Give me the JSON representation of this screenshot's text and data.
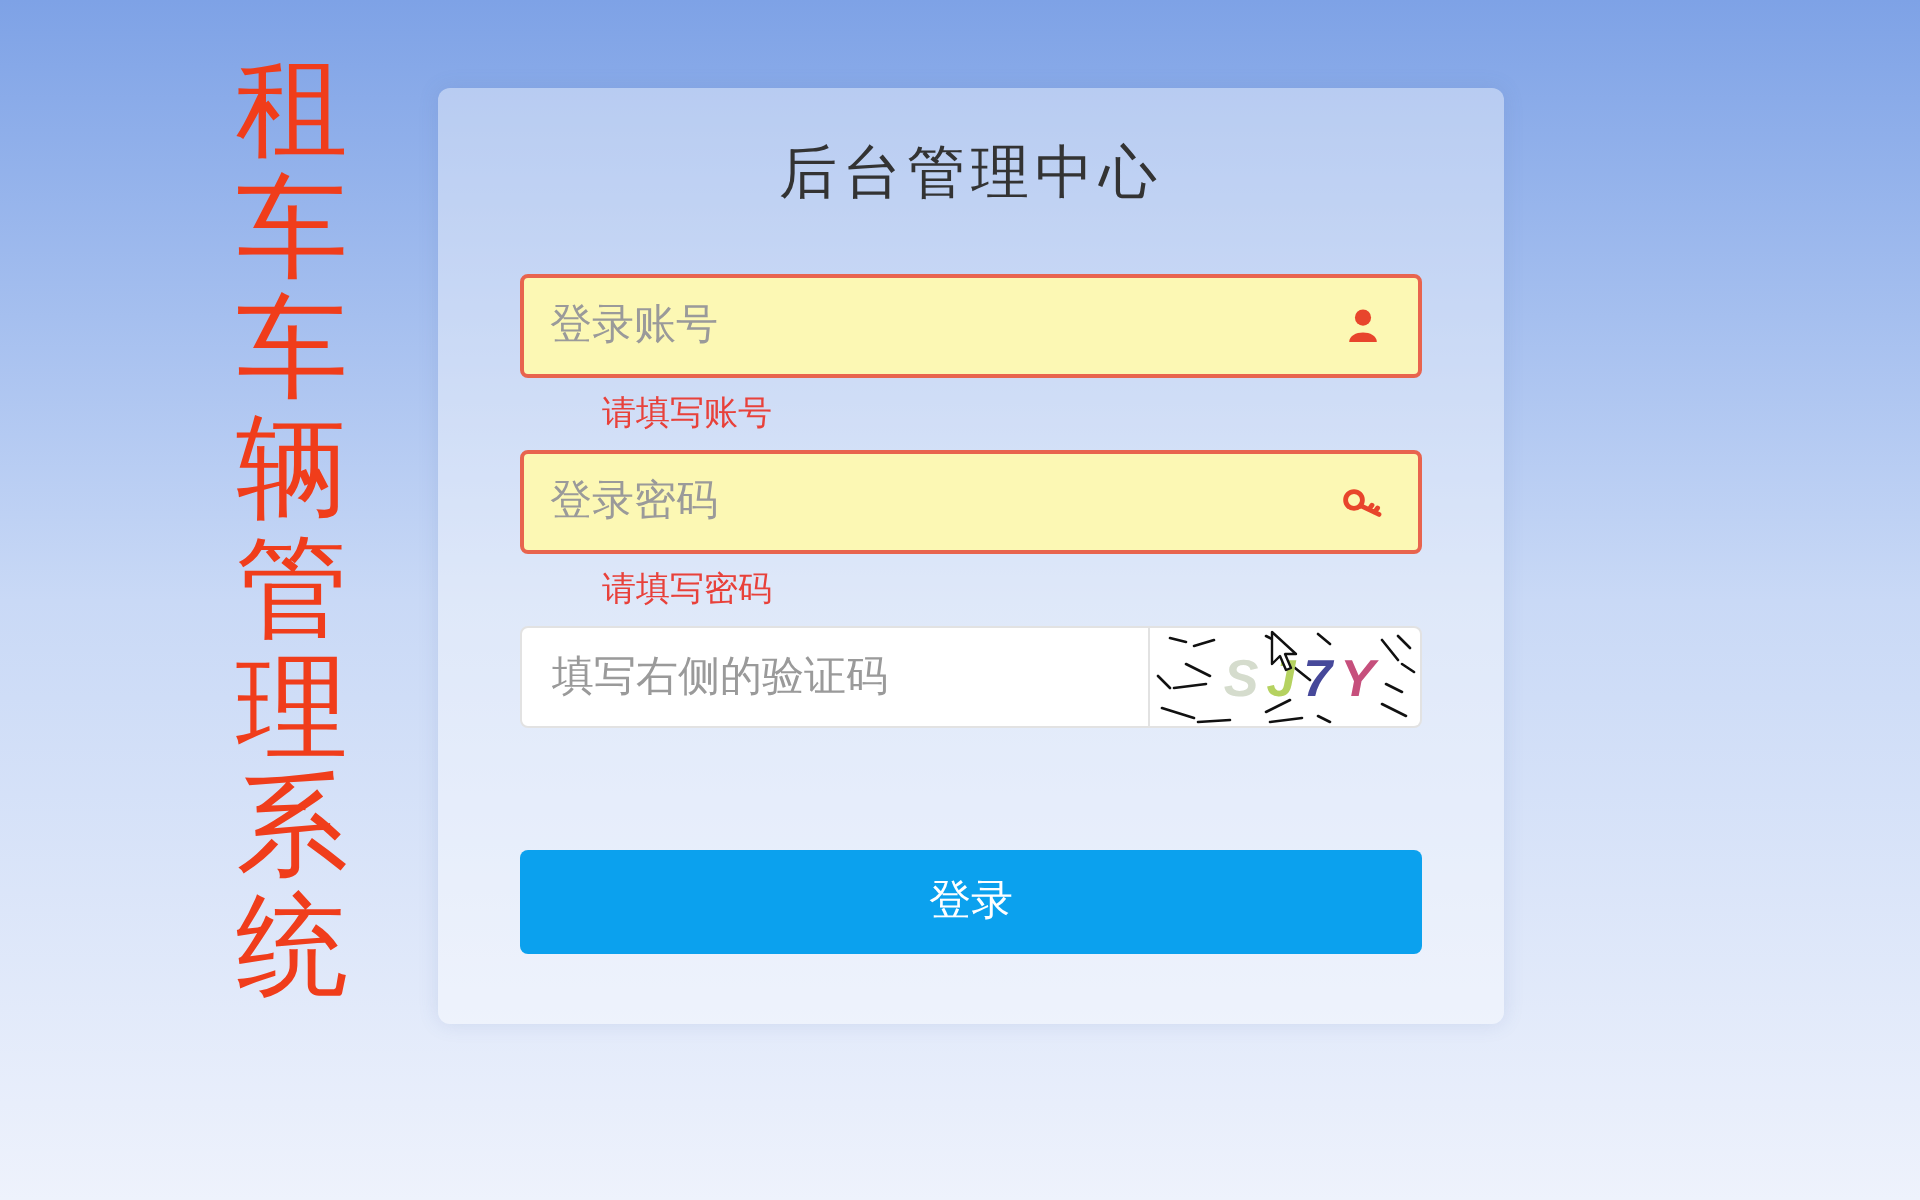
{
  "side_title": "租车车辆管理系统",
  "login_card": {
    "title": "后台管理中心",
    "fields": [
      {
        "kind": "account",
        "placeholder": "登录账号",
        "invalid": true,
        "error": "请填写账号"
      },
      {
        "kind": "password",
        "placeholder": "登录密码",
        "invalid": true,
        "error": "请填写密码"
      }
    ],
    "captcha": {
      "placeholder": "填写右侧的验证码",
      "chars": [
        {
          "char": "S",
          "color": "#d5dccd"
        },
        {
          "char": "J",
          "color": "#b5d260"
        },
        {
          "char": "7",
          "color": "#46489a"
        },
        {
          "char": "Y",
          "color": "#c64f7c"
        }
      ]
    },
    "submit": "登录"
  }
}
